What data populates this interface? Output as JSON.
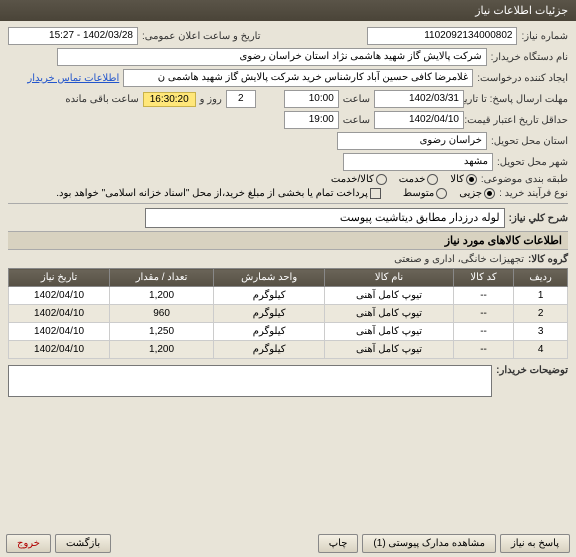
{
  "titlebar": "جزئیات اطلاعات نیاز",
  "labels": {
    "need_no": "شماره نیاز:",
    "pub_datetime": "تاریخ و ساعت اعلان عمومی:",
    "buyer": "نام دستگاه خریدار:",
    "creator": "ایجاد کننده درخواست:",
    "contact_link": "اطلاعات تماس خریدار",
    "deadline": "مهلت ارسال پاسخ: تا تاریخ:",
    "time": "ساعت",
    "day_and": "روز و",
    "remaining": "ساعت باقی مانده",
    "valid_until": "حداقل تاریخ اعتبار قیمت: تا تاریخ:",
    "province": "استان محل تحویل:",
    "city": "شهر محل تحویل:",
    "category": "طبقه بندی موضوعی:",
    "goods": "کالا",
    "service": "خدمت",
    "goods_service": "کالا/خدمت",
    "purchase_type": "نوع فرآیند خرید :",
    "minor": "جزیی",
    "medium": "متوسط",
    "partial_pay": "پرداخت تمام یا بخشی از مبلغ خرید،از محل \"اسناد خزانه اسلامی\" خواهد بود.",
    "summary": "شرح کلي نياز:",
    "items_hdr": "اطلاعات کالاهای مورد نیاز",
    "group": "گروه کالا:",
    "buyer_notes": "توضیحات خریدار:"
  },
  "values": {
    "need_no": "1102092134000802",
    "pub_datetime": "1402/03/28 - 15:27",
    "buyer": "شرکت پالایش گاز شهید هاشمی نژاد   استان خراسان رضوی",
    "creator": "غلامرضا کافی حسین آباد کارشناس خرید  شرکت پالایش گاز شهید هاشمی ن",
    "deadline_date": "1402/03/31",
    "deadline_time": "10:00",
    "days": "2",
    "countdown": "16:30:20",
    "valid_date": "1402/04/10",
    "valid_time": "19:00",
    "province": "خراسان رضوی",
    "city": "مشهد",
    "summary": "لوله درزدار مطابق دیتاشیت پیوست",
    "group": "تجهیزات خانگی، اداری و صنعتی"
  },
  "table": {
    "headers": [
      "ردیف",
      "کد کالا",
      "نام کالا",
      "واحد شمارش",
      "تعداد / مقدار",
      "تاریخ نیاز"
    ],
    "rows": [
      [
        "1",
        "--",
        "تیوپ کامل آهنی",
        "کیلوگرم",
        "1,200",
        "1402/04/10"
      ],
      [
        "2",
        "--",
        "تیوپ کامل آهنی",
        "کیلوگرم",
        "960",
        "1402/04/10"
      ],
      [
        "3",
        "--",
        "تیوپ کامل آهنی",
        "کیلوگرم",
        "1,250",
        "1402/04/10"
      ],
      [
        "4",
        "--",
        "تیوپ کامل آهنی",
        "کیلوگرم",
        "1,200",
        "1402/04/10"
      ]
    ]
  },
  "buttons": {
    "respond": "پاسخ به نیاز",
    "attachments": "مشاهده مدارک پیوستی (1)",
    "print": "چاپ",
    "back": "بازگشت",
    "exit": "خروج"
  }
}
